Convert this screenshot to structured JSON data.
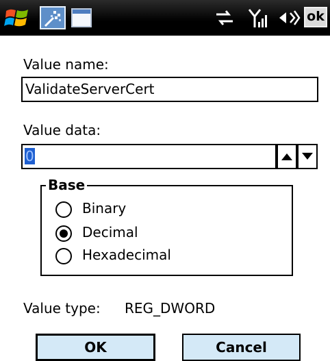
{
  "status_bar": {
    "icons": [
      "windows-start-icon",
      "registry-app-icon",
      "window-icon",
      "sync-icon",
      "signal-icon",
      "volume-icon"
    ],
    "ok_label": "ok"
  },
  "form": {
    "value_name_label": "Value name:",
    "value_name": "ValidateServerCert",
    "value_data_label": "Value data:",
    "value_data": "0"
  },
  "base": {
    "legend": "Base",
    "options": [
      {
        "label": "Binary",
        "checked": false
      },
      {
        "label": "Decimal",
        "checked": true
      },
      {
        "label": "Hexadecimal",
        "checked": false
      }
    ]
  },
  "value_type": {
    "label": "Value type:",
    "value": "REG_DWORD"
  },
  "buttons": {
    "ok": "OK",
    "cancel": "Cancel"
  }
}
